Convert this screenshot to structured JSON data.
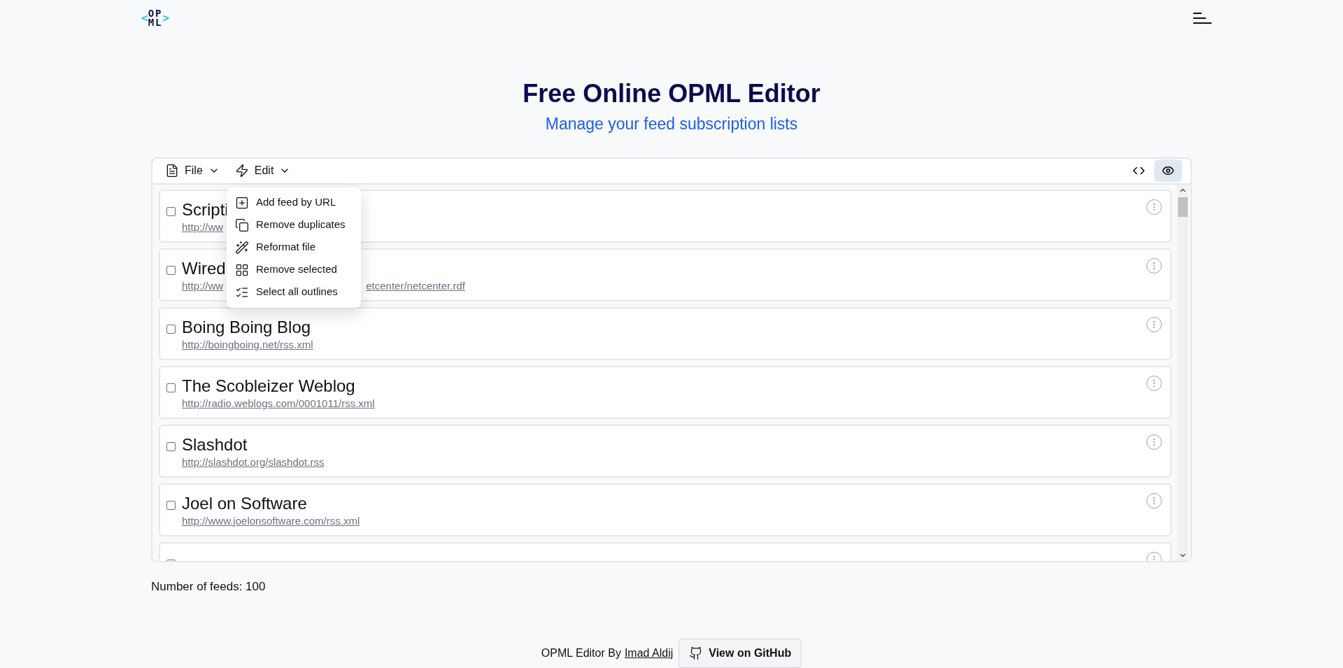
{
  "logo": {
    "left": "<",
    "top": "OP",
    "bottom": "ML",
    "right": ">"
  },
  "title": "Free Online OPML Editor",
  "subtitle": "Manage your feed subscription lists",
  "toolbar": {
    "menus": [
      {
        "label": "File",
        "kind": "file"
      },
      {
        "label": "Edit",
        "kind": "edit"
      }
    ],
    "view_buttons": [
      {
        "kind": "code",
        "selected": false
      },
      {
        "kind": "preview",
        "selected": true
      }
    ]
  },
  "edit_menu": [
    {
      "label": "Add feed by URL",
      "kind": "add"
    },
    {
      "label": "Remove duplicates",
      "kind": "duplicates"
    },
    {
      "label": "Reformat file",
      "kind": "wand"
    },
    {
      "label": "Remove selected",
      "kind": "remove"
    },
    {
      "label": "Select all outlines",
      "kind": "select-all"
    }
  ],
  "feeds": [
    {
      "title": "Scripti",
      "url": "http://ww",
      "checked": false
    },
    {
      "title": "Wired",
      "url": "http://ww",
      "url_tail": "etcenter/netcenter.rdf",
      "checked": false
    },
    {
      "title": "Boing Boing Blog",
      "url": "http://boingboing.net/rss.xml",
      "checked": false
    },
    {
      "title": "The Scobleizer Weblog",
      "url": "http://radio.weblogs.com/0001011/rss.xml",
      "checked": false
    },
    {
      "title": "Slashdot",
      "url": "http://slashdot.org/slashdot.rss",
      "checked": false
    },
    {
      "title": "Joel on Software",
      "url": "http://www.joelonsoftware.com/rss.xml",
      "checked": false
    },
    {
      "checked": false
    }
  ],
  "feed_count": "Number of feeds: 100",
  "footer": {
    "text": "OPML Editor By",
    "author": "Imad Aldij",
    "github_button": "View on GitHub"
  }
}
